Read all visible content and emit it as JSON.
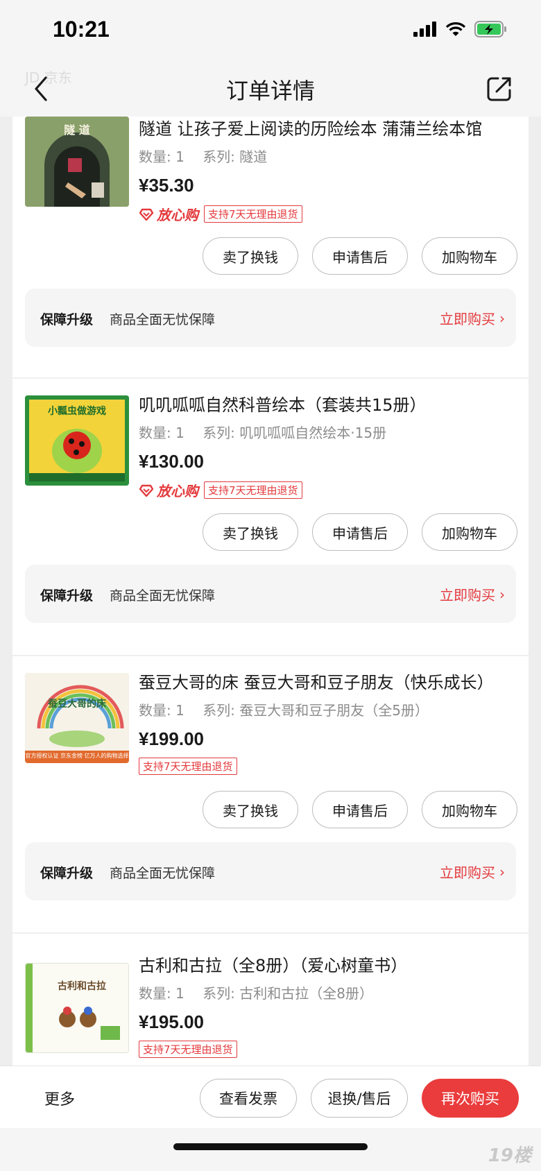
{
  "status_bar": {
    "time": "10:21"
  },
  "nav": {
    "title": "订单详情",
    "watermark": "JD 京东"
  },
  "products": [
    {
      "title": "隧道 让孩子爱上阅读的历险绘本 蒲蒲兰绘本馆",
      "qty": "数量: 1",
      "series": "系列: 隧道",
      "price": "¥35.30",
      "trust_badge": "放心购",
      "return_tag": "支持7天无理由退货",
      "cover_text": "隧 道"
    },
    {
      "title": "叽叽呱呱自然科普绘本（套装共15册）",
      "qty": "数量: 1",
      "series": "系列: 叽叽呱呱自然绘本·15册",
      "price": "¥130.00",
      "trust_badge": "放心购",
      "return_tag": "支持7天无理由退货",
      "cover_text": "小瓢虫做游戏"
    },
    {
      "title": "蚕豆大哥的床  蚕豆大哥和豆子朋友（快乐成长）",
      "qty": "数量: 1",
      "series": "系列: 蚕豆大哥和豆子朋友（全5册）",
      "price": "¥199.00",
      "return_tag": "支持7天无理由退货",
      "cover_text": "蚕豆大哥的床",
      "cover_footer": "官方授权认证  京东金榜  亿万人的购物选择"
    },
    {
      "title": "古利和古拉（全8册）（爱心树童书）",
      "qty": "数量: 1",
      "series": "系列: 古利和古拉（全8册）",
      "price": "¥195.00",
      "return_tag": "支持7天无理由退货",
      "cover_text": "古利和古拉"
    }
  ],
  "product_buttons": {
    "sell": "卖了换钱",
    "after_sale": "申请售后",
    "add_cart": "加购物车"
  },
  "guarantee": {
    "label": "保障升级",
    "desc": "商品全面无忧保障",
    "action": "立即购买"
  },
  "bottom_bar": {
    "more": "更多",
    "invoice": "查看发票",
    "return": "退换/售后",
    "rebuy": "再次购买"
  },
  "corner_logo": "19楼",
  "colors": {
    "accent": "#e4393c",
    "primary_button": "#ea3c3c"
  }
}
